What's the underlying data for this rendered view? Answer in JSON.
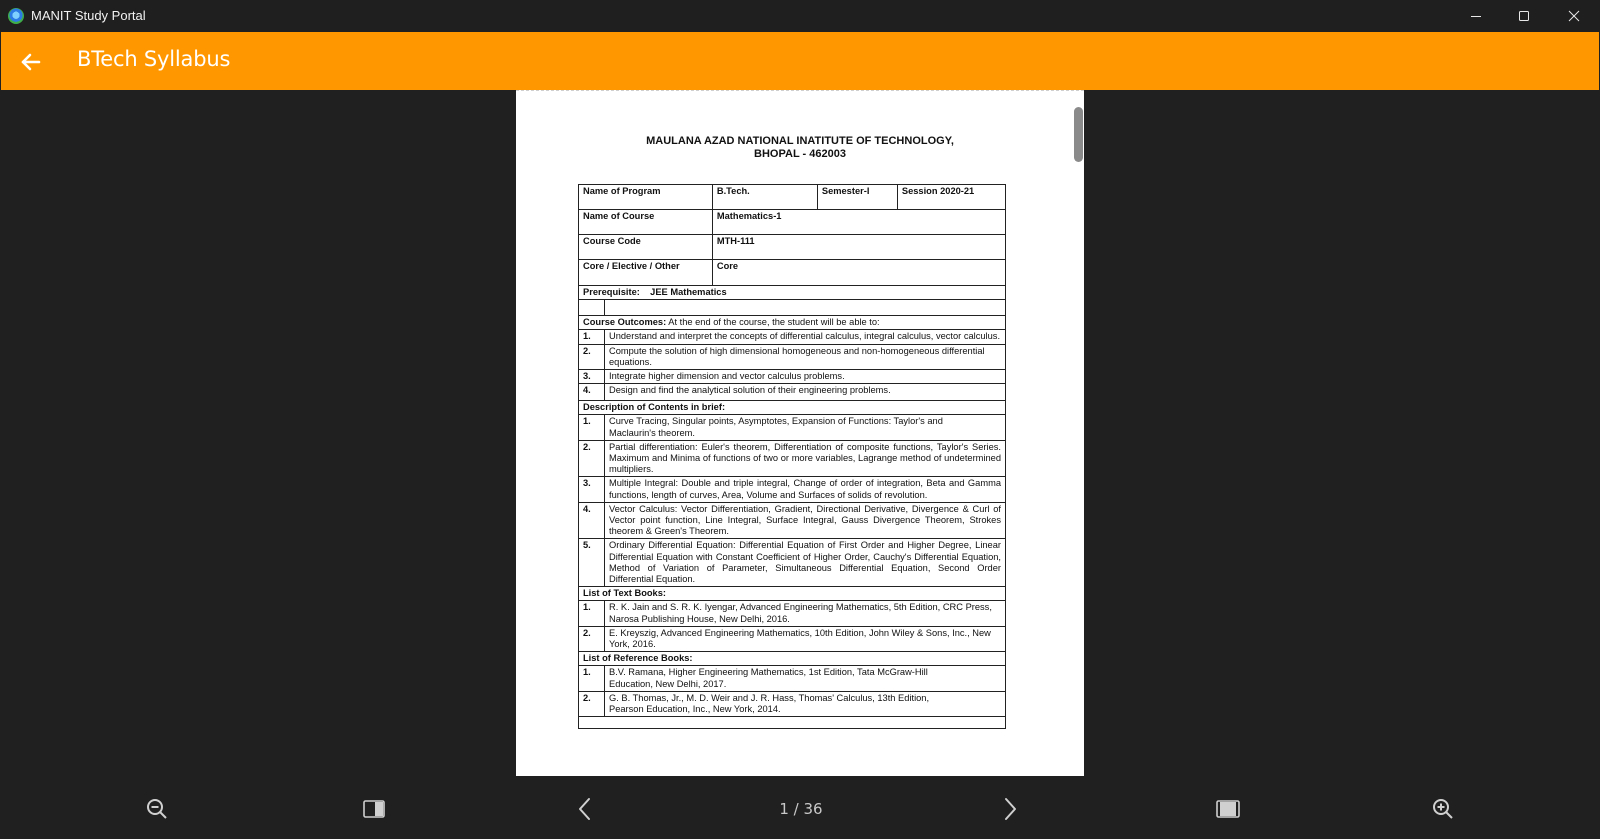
{
  "window": {
    "title": "MANIT Study Portal",
    "icon": "manit-logo-icon"
  },
  "appbar": {
    "back_icon": "arrow-left-icon",
    "title": "BTech Syllabus"
  },
  "document": {
    "header_line1": "MAULANA AZAD NATIONAL INATITUTE OF TECHNOLOGY,",
    "header_line2": "BHOPAL - 462003",
    "program_label": "Name of Program",
    "program_value": "B.Tech.",
    "semester": "Semester-I",
    "session": "Session 2020-21",
    "course_label": "Name of Course",
    "course_value": "Mathematics-1",
    "code_label": "Course Code",
    "code_value": "MTH-111",
    "type_label": "Core / Elective / Other",
    "type_value": "Core",
    "prereq": "Prerequisite:    JEE Mathematics",
    "outcomes_title": "Course Outcomes:",
    "outcomes_intro": " At the end of the course, the student will be able to:",
    "outcomes": [
      {
        "num": "1.",
        "text": "Understand and interpret the concepts of differential calculus, integral calculus, vector calculus."
      },
      {
        "num": "2.",
        "text": "Compute the solution of high dimensional homogeneous and non-homogeneous differential equations."
      },
      {
        "num": "3.",
        "text": "Integrate higher dimension and vector calculus problems."
      },
      {
        "num": "4.",
        "text": "Design and find the analytical solution of their engineering problems."
      }
    ],
    "contents_title": "Description of Contents in brief:",
    "contents": [
      {
        "num": "1.",
        "text": "Curve Tracing, Singular points, Asymptotes, Expansion of Functions: Taylor's and Maclaurin's theorem."
      },
      {
        "num": "2.",
        "text": "Partial differentiation: Euler's theorem, Differentiation of composite functions, Taylor's Series. Maximum and Minima of functions of two or more variables, Lagrange method of undetermined multipliers."
      },
      {
        "num": "3.",
        "text": "Multiple Integral: Double and triple integral, Change of order of integration, Beta and Gamma functions, length of curves, Area, Volume and Surfaces of solids of revolution."
      },
      {
        "num": "4.",
        "text": "Vector Calculus: Vector Differentiation, Gradient, Directional Derivative, Divergence & Curl of Vector point function, Line Integral, Surface Integral, Gauss Divergence Theorem, Strokes theorem & Green's Theorem."
      },
      {
        "num": "5.",
        "text": "Ordinary Differential Equation: Differential Equation of First Order and Higher Degree, Linear Differential Equation with Constant Coefficient of Higher Order, Cauchy's Differential Equation, Method of Variation of Parameter, Simultaneous Differential Equation, Second Order Differential Equation."
      }
    ],
    "textbooks_title": "List of Text Books:",
    "textbooks": [
      {
        "num": "1.",
        "text": "R. K. Jain and S. R. K. Iyengar, Advanced Engineering Mathematics, 5th Edition, CRC Press, Narosa Publishing House, New Delhi, 2016."
      },
      {
        "num": "2.",
        "text": "E. Kreyszig, Advanced Engineering Mathematics, 10th Edition, John Wiley & Sons, Inc., New York, 2016."
      }
    ],
    "references_title": "List of Reference Books:",
    "references": [
      {
        "num": "1.",
        "text": "B.V. Ramana, Higher Engineering Mathematics, 1st Edition, Tata McGraw-Hill Education, New Delhi, 2017."
      },
      {
        "num": "2.",
        "text": "G. B. Thomas, Jr., M. D. Weir and J. R. Hass, Thomas' Calculus, 13th Edition, Pearson Education, Inc., New York, 2014."
      }
    ]
  },
  "bottombar": {
    "zoom_out_icon": "zoom-out-icon",
    "single_page_icon": "single-page-view-icon",
    "prev_icon": "chevron-left-icon",
    "page_indicator": "1 / 36",
    "next_icon": "chevron-right-icon",
    "fit_width_icon": "fit-width-icon",
    "zoom_in_icon": "zoom-in-icon"
  },
  "colors": {
    "accent": "#FF9800",
    "background": "#202020",
    "titlebar": "#1F1F1F"
  }
}
